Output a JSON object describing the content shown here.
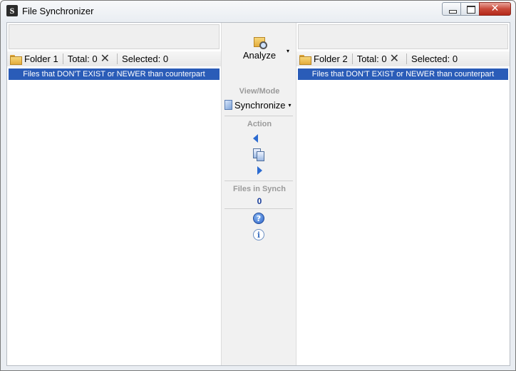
{
  "window": {
    "title": "File Synchronizer",
    "close_glyph": "✕"
  },
  "left_pane": {
    "folder_label": "Folder 1",
    "total_label": "Total: 0",
    "selected_label": "Selected: 0",
    "clear_glyph": "✕",
    "filter_text": "Files that DON'T EXIST or NEWER than counterpart"
  },
  "right_pane": {
    "folder_label": "Folder 2",
    "total_label": "Total: 0",
    "selected_label": "Selected: 0",
    "clear_glyph": "✕",
    "filter_text": "Files that DON'T EXIST or NEWER than counterpart"
  },
  "middle": {
    "analyze_label": "Analyze",
    "dropdown_glyph": "▾",
    "view_mode_title": "View/Mode",
    "mode_label": "Synchronize",
    "action_title": "Action",
    "files_in_synch_title": "Files in Synch",
    "files_in_synch_count": "0",
    "help_glyph": "?",
    "info_glyph": "i"
  },
  "colors": {
    "filter_bar_bg": "#2a5cb8",
    "count_color": "#1b3f9c",
    "arrow_color": "#2c6bd1"
  }
}
